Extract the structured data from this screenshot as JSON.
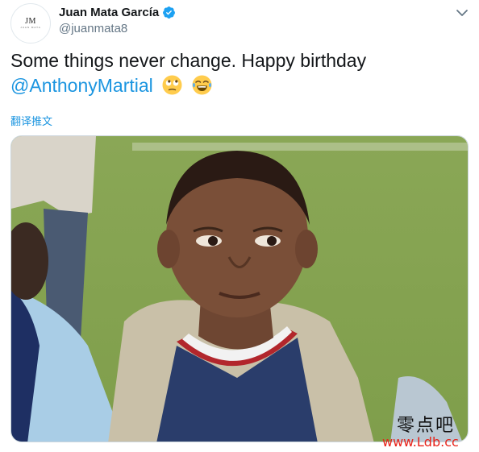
{
  "author": {
    "name": "Juan Mata García",
    "handle": "@juanmata8",
    "avatar_monogram": "JM",
    "avatar_subtext": "JUAN MATA"
  },
  "tweet": {
    "text": "Some things never change. Happy birthday ",
    "mention": "@AnthonyMartial",
    "emojis": [
      "face-with-rolling-eyes",
      "face-with-tears-of-joy"
    ]
  },
  "translate_label": "翻译推文",
  "media": {
    "description_icon": "photo"
  },
  "watermark": {
    "chinese": "零点吧",
    "url": "www.Ldb.cc"
  },
  "colors": {
    "link": "#1b95e0",
    "verified": "#1da1f2",
    "watermark_url": "#e8231a"
  },
  "icons": [
    "verified-badge-icon",
    "chevron-down-icon"
  ]
}
